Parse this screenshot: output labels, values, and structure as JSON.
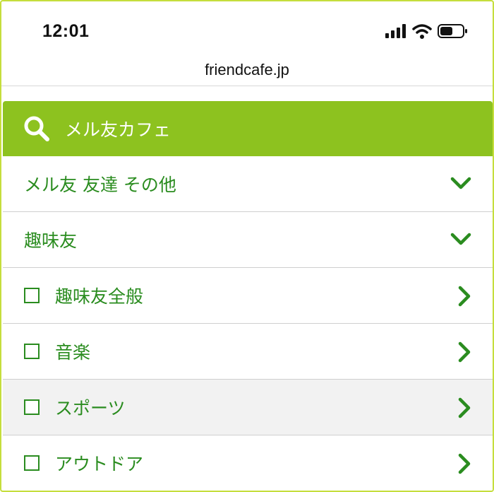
{
  "status_bar": {
    "time": "12:01",
    "icons": [
      "signal-icon",
      "wifi-icon",
      "battery-icon"
    ]
  },
  "browser": {
    "url": "friendcafe.jp"
  },
  "search_header": {
    "icon": "search-icon",
    "title": "メル友カフェ",
    "color": "#8dc21f"
  },
  "categories": [
    {
      "label": "メル友 友達 その他",
      "icon": "chevron-down-icon"
    },
    {
      "label": "趣味友",
      "icon": "chevron-down-icon"
    }
  ],
  "subcategories": [
    {
      "label": "趣味友全般",
      "checked": false,
      "highlighted": false
    },
    {
      "label": "音楽",
      "checked": false,
      "highlighted": false
    },
    {
      "label": "スポーツ",
      "checked": false,
      "highlighted": true
    },
    {
      "label": "アウトドア",
      "checked": false,
      "highlighted": false
    }
  ],
  "colors": {
    "accent_green": "#8dc21f",
    "text_green": "#2a8c1f",
    "row_highlight": "#f2f2f2"
  }
}
